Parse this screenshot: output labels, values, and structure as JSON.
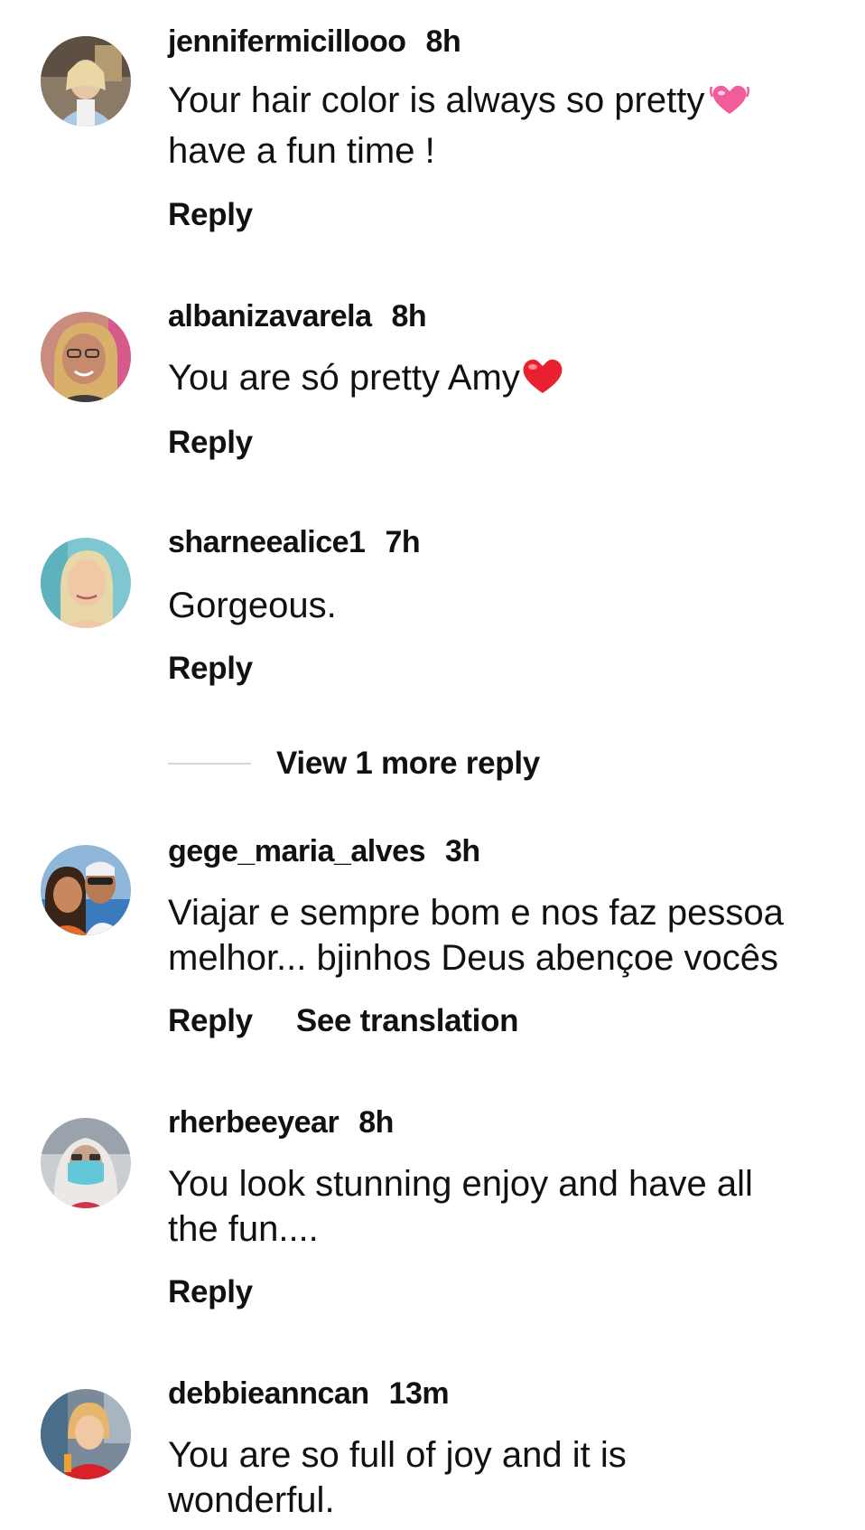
{
  "comments": [
    {
      "username": "jennifermicillooo",
      "time": "8h",
      "text_lines": [
        "Your hair color is always so pretty",
        "have a fun time !"
      ],
      "emoji": "pink-heart-emoji",
      "reply_label": "Reply"
    },
    {
      "username": "albanizavarela",
      "time": "8h",
      "text_lines": [
        "You are só pretty Amy"
      ],
      "emoji": "red-heart-emoji",
      "reply_label": "Reply"
    },
    {
      "username": "sharneealice1",
      "time": "7h",
      "text_lines": [
        "Gorgeous."
      ],
      "reply_label": "Reply"
    },
    {
      "username": "gege_maria_alves",
      "time": "3h",
      "text_lines": [
        "Viajar e sempre bom e nos faz pessoa",
        "melhor... bjinhos Deus abençoe vocês"
      ],
      "reply_label": "Reply",
      "translate_label": "See translation"
    },
    {
      "username": "rherbeeyear",
      "time": "8h",
      "text_lines": [
        "You look stunning enjoy and have all",
        "the fun...."
      ],
      "reply_label": "Reply"
    },
    {
      "username": "debbieanncan",
      "time": "13m",
      "text_lines": [
        "You are so full of joy and it is",
        "wonderful."
      ]
    }
  ],
  "view_more_replies": "View 1 more reply",
  "colors": {
    "text": "#111111",
    "divider": "#d8d8d8",
    "pink_heart": "#f25c9b",
    "red_heart": "#e8202f"
  }
}
